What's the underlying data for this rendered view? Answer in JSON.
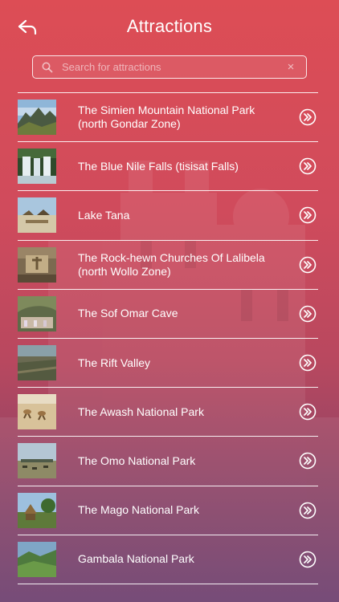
{
  "header": {
    "title": "Attractions",
    "back_icon": "back-arrow-icon"
  },
  "search": {
    "placeholder": "Search for attractions",
    "value": "",
    "clear_symbol": "×"
  },
  "attractions": [
    {
      "label": "The Simien Mountain National Park (north Gondar Zone)",
      "thumb": "mountain-photo"
    },
    {
      "label": "The Blue Nile Falls (tisisat Falls)",
      "thumb": "waterfall-photo"
    },
    {
      "label": "Lake Tana",
      "thumb": "lake-photo"
    },
    {
      "label": "The Rock-hewn Churches Of Lalibela (north Wollo Zone)",
      "thumb": "rock-church-photo"
    },
    {
      "label": "The Sof Omar Cave",
      "thumb": "cave-photo"
    },
    {
      "label": "The Rift Valley",
      "thumb": "valley-photo"
    },
    {
      "label": "The Awash National Park",
      "thumb": "savanna-photo"
    },
    {
      "label": "The Omo National Park",
      "thumb": "plains-photo"
    },
    {
      "label": "The Mago National Park",
      "thumb": "huts-photo"
    },
    {
      "label": "Gambala National Park",
      "thumb": "hills-photo"
    }
  ],
  "colors": {
    "gradient_top": "#dd4d55",
    "gradient_bottom": "#6c3f6e",
    "text": "#ffffff"
  }
}
